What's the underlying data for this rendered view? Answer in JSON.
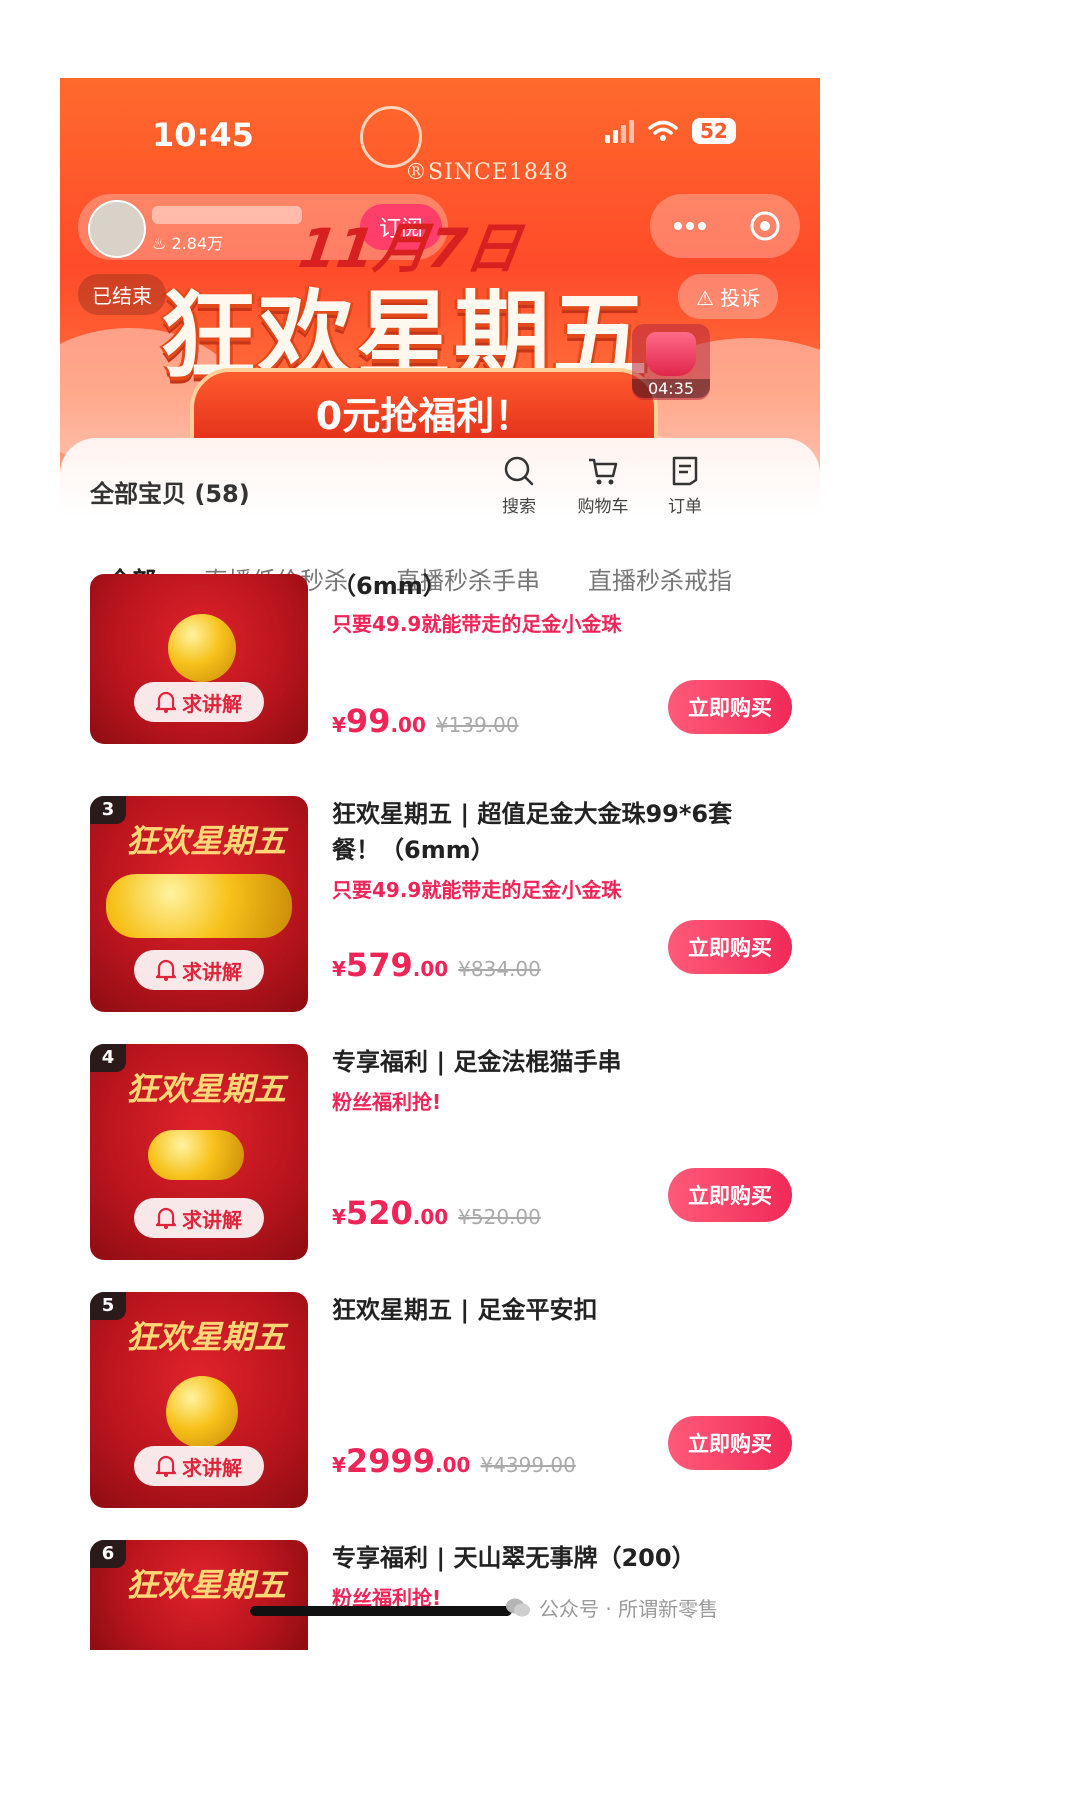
{
  "status_bar": {
    "time": "10:45",
    "battery": "52"
  },
  "brand": {
    "since": "®SINCE1848"
  },
  "shop": {
    "fans": "2.84万",
    "subscribe_label": "订阅"
  },
  "banner": {
    "ended_label": "已结束",
    "complain_label": "投诉",
    "date": "11月7日",
    "headline": "狂欢星期五",
    "ribbon": "0元抢福利！",
    "countdown": "04:35"
  },
  "toolbar": {
    "all_items": "全部宝贝 (58)",
    "search": "搜索",
    "cart": "购物车",
    "orders": "订单"
  },
  "tabs": [
    "全部",
    "直播低价秒杀",
    "直播秒杀手串",
    "直播秒杀戒指"
  ],
  "products": [
    {
      "rank": "",
      "thumb_text": "",
      "title_tail": "（6mm）",
      "slogan": "只要49.9就能带走的足金小金珠",
      "price_symbol": "¥",
      "price_int": "99",
      "price_dec": ".00",
      "old_price": "¥139.00",
      "ask_label": "求讲解",
      "buy_label": "立即购买"
    },
    {
      "rank": "3",
      "thumb_text": "狂欢星期五",
      "title": "狂欢星期五 | 超值足金大金珠99*6套餐！（6mm）",
      "slogan": "只要49.9就能带走的足金小金珠",
      "price_symbol": "¥",
      "price_int": "579",
      "price_dec": ".00",
      "old_price": "¥834.00",
      "ask_label": "求讲解",
      "buy_label": "立即购买"
    },
    {
      "rank": "4",
      "thumb_text": "狂欢星期五",
      "title": "专享福利 | 足金法棍猫手串",
      "slogan": "粉丝福利抢!",
      "price_symbol": "¥",
      "price_int": "520",
      "price_dec": ".00",
      "old_price": "¥520.00",
      "ask_label": "求讲解",
      "buy_label": "立即购买"
    },
    {
      "rank": "5",
      "thumb_text": "狂欢星期五",
      "title": "狂欢星期五 | 足金平安扣",
      "slogan": "",
      "price_symbol": "¥",
      "price_int": "2999",
      "price_dec": ".00",
      "old_price": "¥4399.00",
      "ask_label": "求讲解",
      "buy_label": "立即购买"
    },
    {
      "rank": "6",
      "thumb_text": "狂欢星期五",
      "title": "专享福利 | 天山翠无事牌（200）",
      "slogan": "粉丝福利抢!"
    }
  ],
  "watermark": "公众号 · 所谓新零售",
  "colors": {
    "accent": "#ef2457",
    "banner": "#ff5a2c",
    "thumb_bg": "#b8141d"
  }
}
